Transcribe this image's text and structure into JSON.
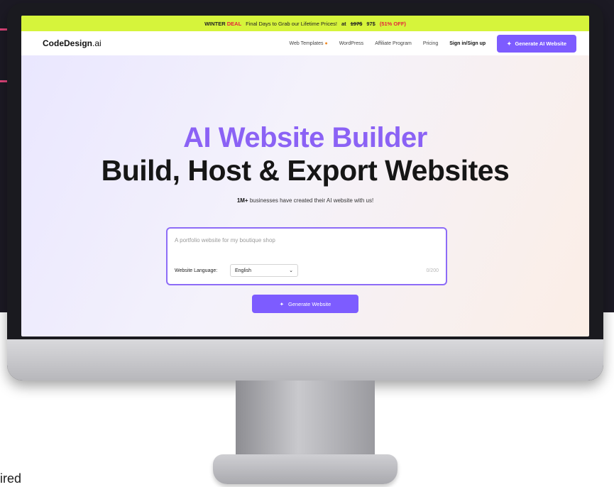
{
  "promo": {
    "deal_prefix": "WINTER",
    "deal_word": "DEAL",
    "message": "Final Days to Grab our Lifetime Prices!",
    "at": "at",
    "old_price": "197$",
    "new_price": "97$",
    "discount": "(51% OFF)"
  },
  "nav": {
    "logo_main": "CodeDesign",
    "logo_suffix": ".ai",
    "links": [
      "Web Templates",
      "WordPress",
      "Affiliate Program",
      "Pricing"
    ],
    "signin": "Sign in/Sign up",
    "cta": "Generate AI Website"
  },
  "hero": {
    "title_line1": "AI Website Builder",
    "title_line2": "Build, Host & Export Websites",
    "sub_bold": "1M+",
    "sub_rest": "businesses have created their AI website with us!"
  },
  "prompt": {
    "placeholder": "A portfolio website for my boutique shop",
    "language_label": "Website Language:",
    "language_value": "English",
    "counter": "0/200"
  },
  "generate_button": "Generate Website",
  "bottom_text": "ired",
  "colors": {
    "accent": "#7d5cff",
    "promo_bg": "#d6f43b",
    "title_purple": "#8b62f5"
  },
  "icons": {
    "fire": "fire-icon",
    "sparkle": "sparkle-icon",
    "chevron": "chevron-down-icon"
  }
}
